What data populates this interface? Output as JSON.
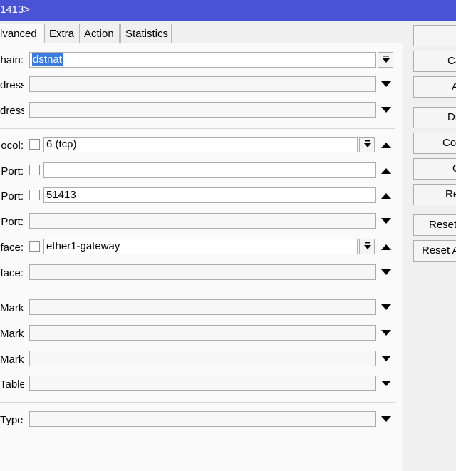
{
  "window": {
    "title": "1413>"
  },
  "tabs": [
    "lvanced",
    "Extra",
    "Action",
    "Statistics"
  ],
  "fields": {
    "chain": {
      "label": "hain:",
      "value": "dstnat"
    },
    "src_address": {
      "label": "dress:"
    },
    "dst_address": {
      "label": "dress:"
    },
    "protocol": {
      "label": "ocol:",
      "value": "6 (tcp)"
    },
    "src_port": {
      "label": "Port:"
    },
    "dst_port": {
      "label": "Port:",
      "value": "51413"
    },
    "any_port": {
      "label": "Port:"
    },
    "in_interface": {
      "label": "face:",
      "value": "ether1-gateway"
    },
    "out_interface": {
      "label": "face:"
    },
    "packet_mark": {
      "label": "Mark:"
    },
    "connection_mark": {
      "label": "Mark:"
    },
    "routing_mark": {
      "label": "Mark:"
    },
    "routing_table": {
      "label": "Table:"
    },
    "connection_type": {
      "label": "Type:"
    }
  },
  "buttons": {
    "ok": "",
    "cancel": "Ca",
    "apply": "A",
    "disable": "Di",
    "comment": "Co",
    "copy": "C",
    "remove": "Re",
    "reset_counters": "Reset",
    "reset_all_counters": "Reset A"
  }
}
